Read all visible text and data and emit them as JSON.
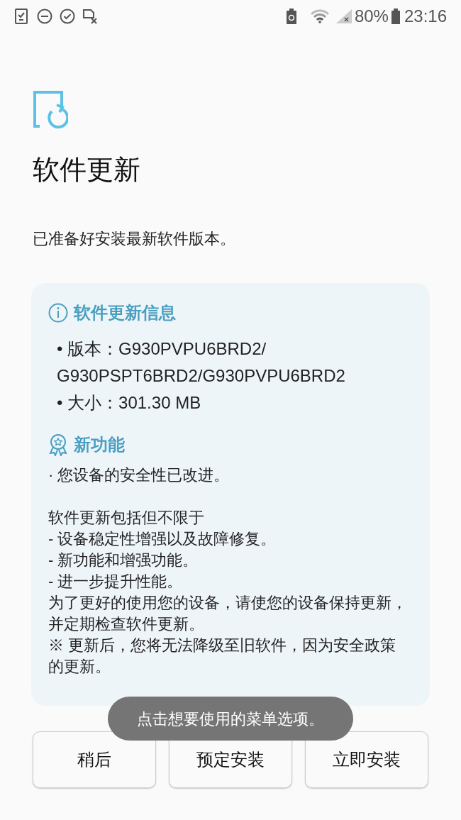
{
  "status_bar": {
    "battery_percent": "80%",
    "time": "23:16"
  },
  "title": "软件更新",
  "subtitle": "已准备好安装最新软件版本。",
  "info": {
    "heading": "软件更新信息",
    "items": [
      "• 版本：G930PVPU6BRD2/ G930PSPT6BRD2/G930PVPU6BRD2",
      "• 大小：301.30 MB"
    ]
  },
  "features": {
    "heading": "新功能",
    "paragraphs": [
      [
        "· 您设备的安全性已改进。"
      ],
      [
        "软件更新包括但不限于",
        "- 设备稳定性增强以及故障修复。",
        "- 新功能和增强功能。",
        "- 进一步提升性能。",
        "为了更好的使用您的设备，请使您的设备保持更新，并定期检查软件更新。",
        "※ 更新后，您将无法降级至旧软件，因为安全政策的更新。"
      ]
    ]
  },
  "toast": "点击想要使用的菜单选项。",
  "buttons": [
    "稍后",
    "预定安装",
    "立即安装"
  ]
}
